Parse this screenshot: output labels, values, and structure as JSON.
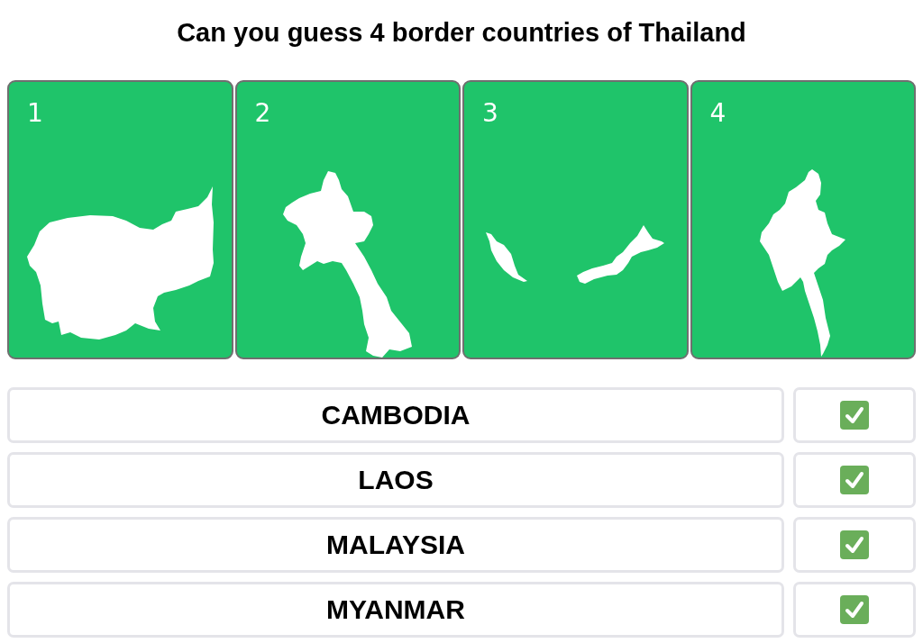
{
  "title": "Can you guess 4 border countries of Thailand",
  "cards": [
    {
      "number": "1"
    },
    {
      "number": "2"
    },
    {
      "number": "3"
    },
    {
      "number": "4"
    }
  ],
  "answers": [
    {
      "name": "CAMBODIA",
      "checked": true
    },
    {
      "name": "LAOS",
      "checked": true
    },
    {
      "name": "MALAYSIA",
      "checked": true
    },
    {
      "name": "MYANMAR",
      "checked": true
    }
  ]
}
